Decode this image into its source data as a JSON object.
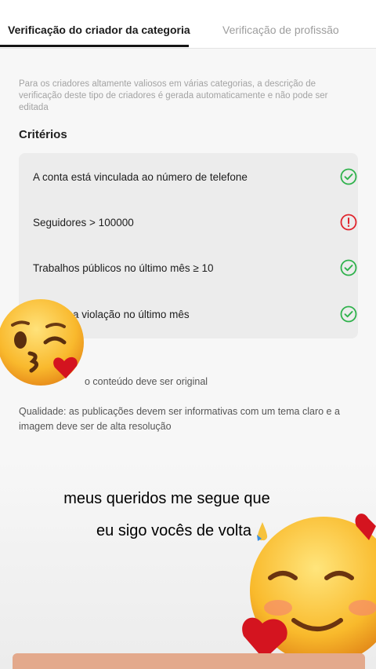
{
  "tabs": [
    {
      "label": "Verificação do criador da categoria",
      "active": true
    },
    {
      "label": "Verificação de profissão",
      "active": false
    }
  ],
  "description": "Para os criadores altamente valiosos em várias categorias, a descrição de verificação deste tipo de criadores é gerada automaticamente e não pode ser editada",
  "criteria": {
    "title": "Critérios",
    "items": [
      {
        "label": "A conta está vinculada ao número de telefone",
        "status": "ok"
      },
      {
        "label": "Seguidores > 100000",
        "status": "warning"
      },
      {
        "label": "Trabalhos públicos no último mês ≥ 10",
        "status": "ok"
      },
      {
        "label": "Nenhuma violação no último mês",
        "visible_label": "ma violação no último mês",
        "status": "ok"
      }
    ]
  },
  "notes": {
    "originality": "o conteúdo deve ser original",
    "quality": "Qualidade: as publicações devem ser informativas com um tema claro e a imagem deve ser de alta resolução"
  },
  "overlay": {
    "caption_line1": "meus queridos me segue que",
    "caption_line2": "eu sigo vocês de volta",
    "emoji_top": "kissing-face-emoji",
    "emoji_bottom": "smiling-face-with-hearts-emoji"
  },
  "colors": {
    "ok": "#2fb24c",
    "warning": "#e0242c",
    "card_bg": "#ececec"
  }
}
